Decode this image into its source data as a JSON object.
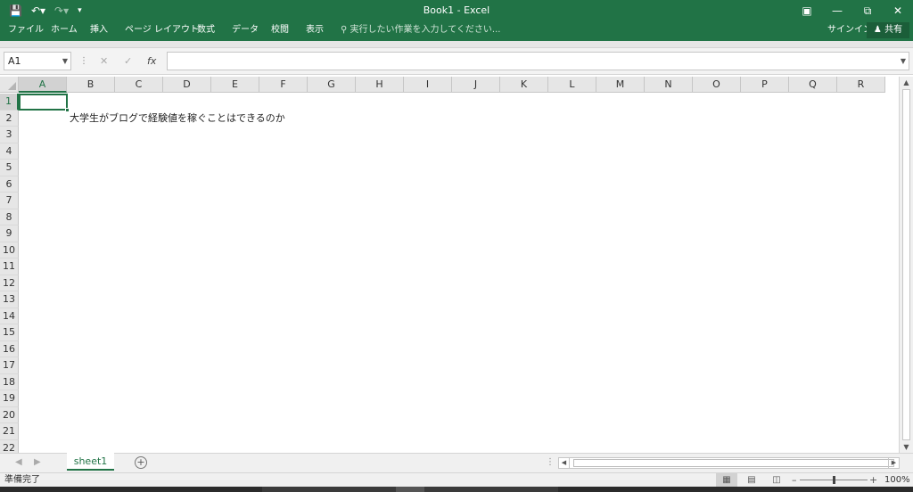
{
  "titlebar": {
    "title": "Book1 - Excel",
    "save_icon": "save-icon",
    "undo_icon": "undo-icon",
    "redo_icon": "redo-icon",
    "ribbon_display_icon": "ribbon-display-icon",
    "minimize_icon": "minimize-icon",
    "restore_icon": "restore-icon",
    "close_icon": "close-icon"
  },
  "ribbon": {
    "tabs": [
      "ファイル",
      "ホーム",
      "挿入",
      "ページ レイアウト",
      "数式",
      "データ",
      "校閲",
      "表示"
    ],
    "tell_me_placeholder": "実行したい作業を入力してください...",
    "signin": "サインイン",
    "share": "共有"
  },
  "formula_bar": {
    "name_box": "A1",
    "fx_label": "fx",
    "formula": ""
  },
  "sheet": {
    "columns": [
      "A",
      "B",
      "C",
      "D",
      "E",
      "F",
      "G",
      "H",
      "I",
      "J",
      "K",
      "L",
      "M",
      "N",
      "O",
      "P",
      "Q",
      "R"
    ],
    "rows": [
      "1",
      "2",
      "3",
      "4",
      "5",
      "6",
      "7",
      "8",
      "9",
      "10",
      "11",
      "12",
      "13",
      "14",
      "15",
      "16",
      "17",
      "18",
      "19",
      "20",
      "21",
      "22"
    ],
    "selected_column": "A",
    "selected_row": "1",
    "cells": [
      {
        "ref": "B2",
        "text": "大学生がブログで経験値を稼ぐことはできるのか"
      }
    ]
  },
  "sheet_tabs": {
    "active": "sheet1"
  },
  "status_bar": {
    "status": "準備完了",
    "zoom": "100%",
    "zoom_fraction": 0.5
  },
  "colors": {
    "accent": "#217346"
  }
}
